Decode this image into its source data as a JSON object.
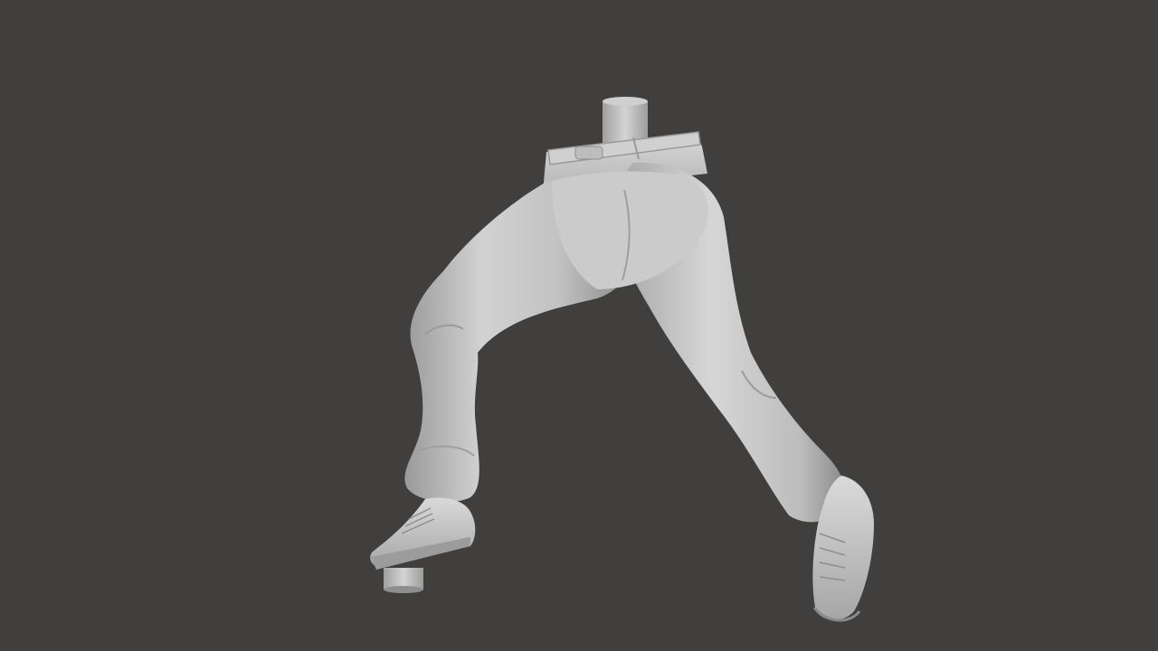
{
  "viewport": {
    "background": "#403f3e",
    "model_color": "#c9c9c9",
    "model_shadow": "#8a8a8a",
    "model_highlight": "#e6e6e6"
  }
}
